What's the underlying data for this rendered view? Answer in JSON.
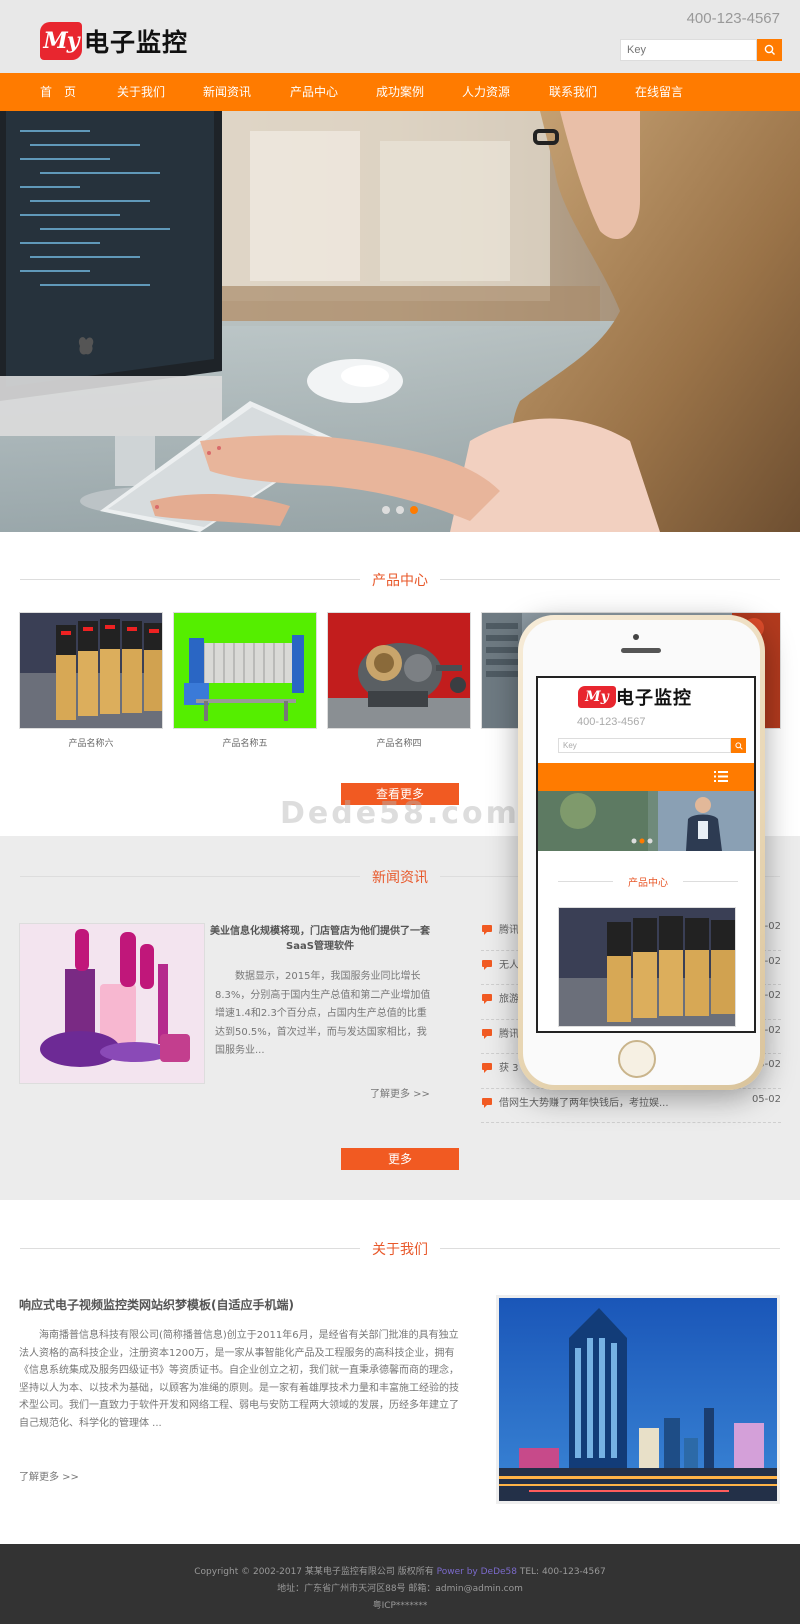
{
  "header": {
    "logo_badge": "My",
    "logo_text": "电子监控",
    "phone": "400-123-4567",
    "search_placeholder": "Key"
  },
  "nav": {
    "items": [
      {
        "label": "首　页"
      },
      {
        "label": "关于我们"
      },
      {
        "label": "新闻资讯"
      },
      {
        "label": "产品中心"
      },
      {
        "label": "成功案例"
      },
      {
        "label": "人力资源"
      },
      {
        "label": "联系我们"
      },
      {
        "label": "在线留言"
      }
    ]
  },
  "banner": {
    "slides_total": 3,
    "active_slide": 3
  },
  "products": {
    "title": "产品中心",
    "items": [
      {
        "name": "产品名称六"
      },
      {
        "name": "产品名称五"
      },
      {
        "name": "产品名称四"
      }
    ],
    "more_label": "查看更多"
  },
  "watermark": "Dede58.com",
  "news": {
    "title": "新闻资讯",
    "featured": {
      "title": "美业信息化规模将现，门店管店为他们提供了一套SaaS管理软件",
      "excerpt": "数据显示，2015年，我国服务业同比增长8.3%，分别高于国内生产总值和第二产业增加值增速1.4和2.3个百分点，占国内生产总值的比重达到50.5%，首次过半，而与发达国家相比，我国服务业...",
      "more": "了解更多 >>"
    },
    "list": [
      {
        "title": "腾讯",
        "date": "05-02"
      },
      {
        "title": "无人",
        "date": "05-02"
      },
      {
        "title": "旅游",
        "date": "05-02"
      },
      {
        "title": "腾讯",
        "date": "05-02"
      },
      {
        "title": "获 3",
        "date": "05-02"
      },
      {
        "title": "借网生大势赚了两年快钱后，考拉娱...",
        "date": "05-02"
      }
    ],
    "more_label": "更多"
  },
  "about": {
    "title": "关于我们",
    "heading": "响应式电子视频监控类网站织梦模板(自适应手机端)",
    "text": "海南播普信息科技有限公司(简称播普信息)创立于2011年6月，是经省有关部门批准的具有独立法人资格的高科技企业，注册资本1200万，是一家从事智能化产品及工程服务的高科技企业，拥有《信息系统集成及服务四级证书》等资质证书。自企业创立之初，我们就一直秉承德馨而商的理念，坚持以人为本、以技术为基础，以顾客为准绳的原则。是一家有着雄厚技术力量和丰富施工经验的技术型公司。我们一直致力于软件开发和网络工程、弱电与安防工程两大领域的发展，历经多年建立了自己规范化、科学化的管理体 ...",
    "more": "了解更多 >>"
  },
  "footer": {
    "copyright": "Copyright © 2002-2017 某某电子监控有限公司 版权所有",
    "powered": "Power by DeDe58",
    "tel": "TEL: 400-123-4567",
    "address": "地址：广东省广州市天河区88号",
    "email": "邮箱：admin@admin.com",
    "icp": "粤ICP*******"
  },
  "mockup": {
    "logo_badge": "My",
    "logo_text": "电子监控",
    "phone": "400-123-4567",
    "search_placeholder": "Key",
    "section_title": "产品中心"
  },
  "colors": {
    "accent": "#ff7b00",
    "button": "#f15a22",
    "title": "#e8582a",
    "footer_bg": "#333333",
    "news_bg": "#ececec"
  }
}
